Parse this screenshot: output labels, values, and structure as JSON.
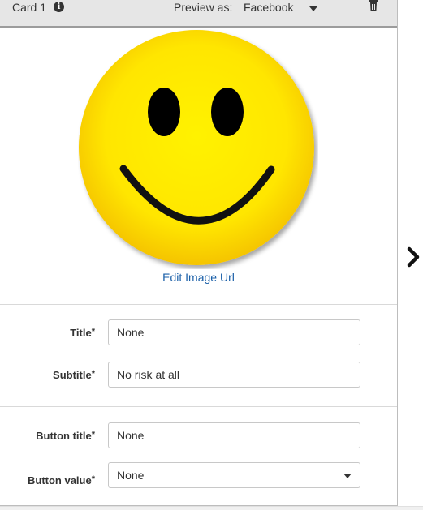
{
  "card": {
    "title": "Card 1",
    "preview_label": "Preview as:",
    "preview_value": "Facebook",
    "image_link": "Edit Image Url"
  },
  "fields": {
    "title": {
      "label": "Title",
      "required_mark": "*",
      "value": "None"
    },
    "subtitle": {
      "label": "Subtitle",
      "required_mark": "*",
      "value": "No risk at all"
    },
    "button_title": {
      "label": "Button title",
      "required_mark": "*",
      "value": "None"
    },
    "button_value": {
      "label": "Button value",
      "required_mark": "*",
      "value": "None"
    }
  },
  "icons": {
    "info": "info-icon",
    "trash": "trash-icon",
    "next": "chevron-right-icon",
    "caret": "caret-down-icon"
  },
  "colors": {
    "header_bg": "#e6e6e6",
    "link": "#1a5fa8",
    "smiley_yellow": "#ffe400"
  }
}
